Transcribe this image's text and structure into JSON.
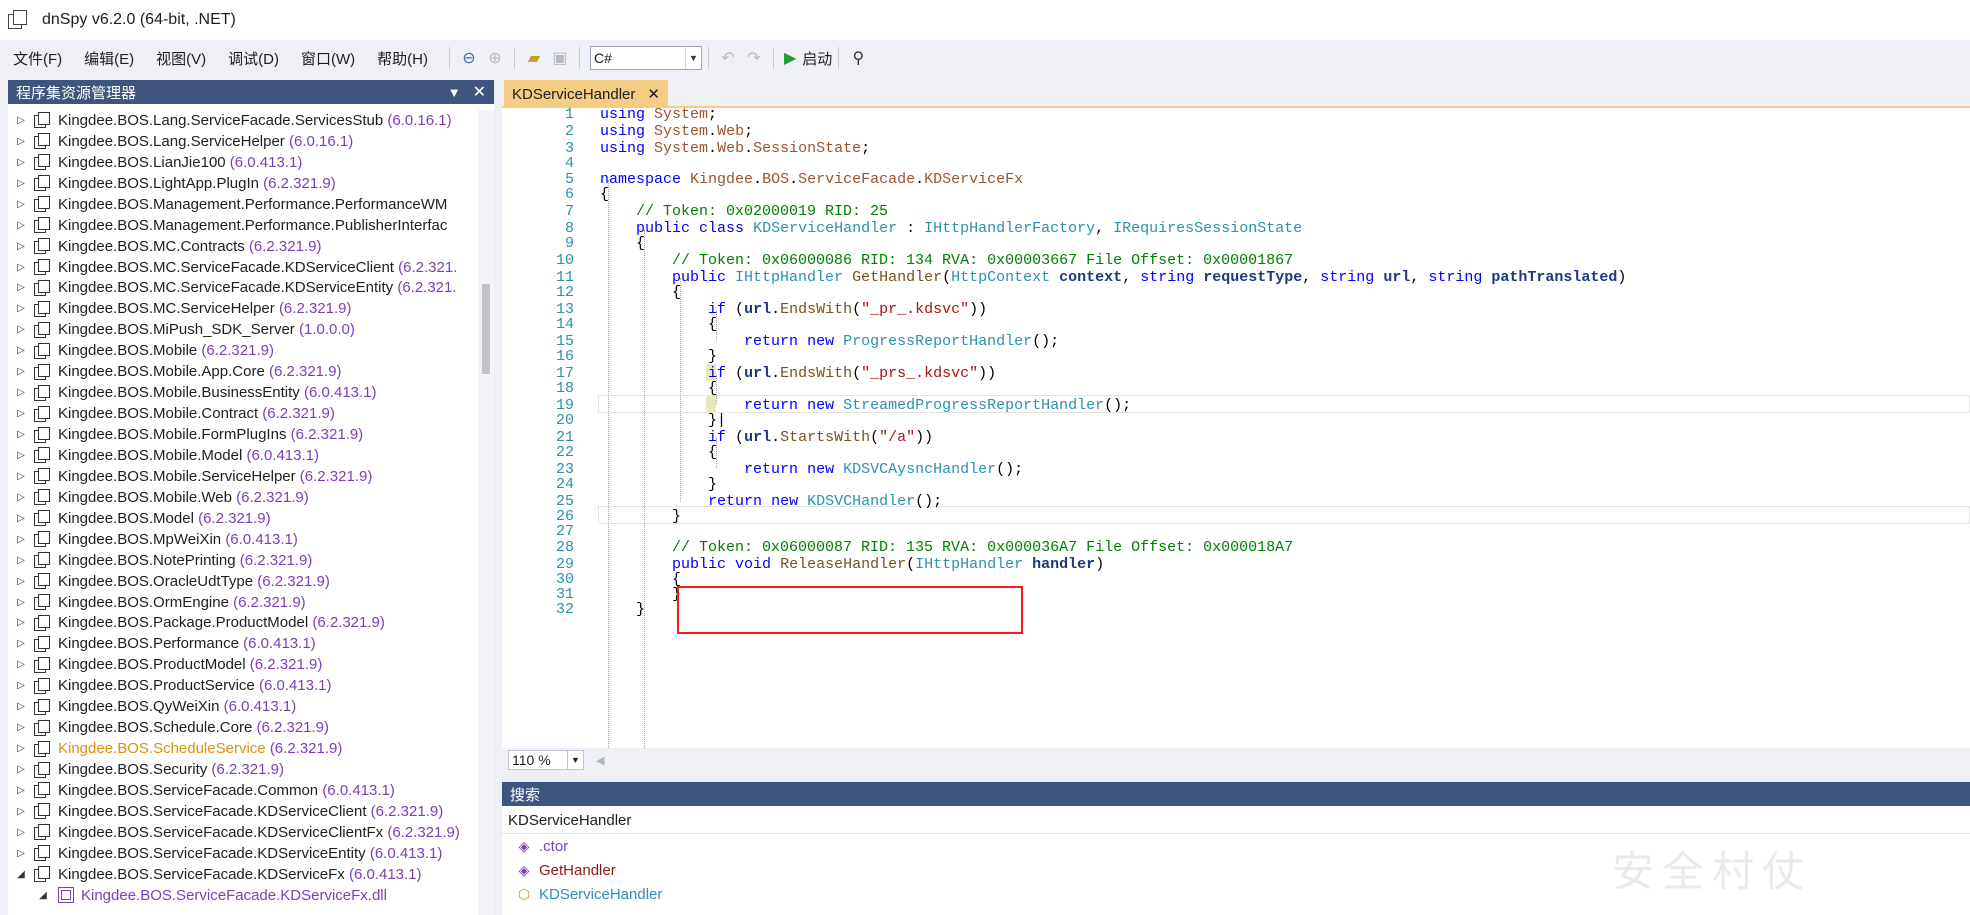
{
  "window": {
    "title": "dnSpy v6.2.0 (64-bit, .NET)"
  },
  "menu": [
    "文件(F)",
    "编辑(E)",
    "视图(V)",
    "调试(D)",
    "窗口(W)",
    "帮助(H)"
  ],
  "toolbar": {
    "language": "C#",
    "run_label": "启动",
    "icons": [
      "back-arrow-icon",
      "forward-arrow-icon",
      "open-folder-icon",
      "save-icon",
      "undo-icon",
      "redo-icon",
      "play-icon",
      "search-icon"
    ]
  },
  "assembly_explorer": {
    "title": "程序集资源管理器",
    "items": [
      {
        "name": "Kingdee.BOS.Lang.ServiceFacade.ServicesStub",
        "version": "(6.0.16.1)"
      },
      {
        "name": "Kingdee.BOS.Lang.ServiceHelper",
        "version": "(6.0.16.1)"
      },
      {
        "name": "Kingdee.BOS.LianJie100",
        "version": "(6.0.413.1)"
      },
      {
        "name": "Kingdee.BOS.LightApp.PlugIn",
        "version": "(6.2.321.9)"
      },
      {
        "name": "Kingdee.BOS.Management.Performance.PerformanceWM",
        "version": ""
      },
      {
        "name": "Kingdee.BOS.Management.Performance.PublisherInterfac",
        "version": ""
      },
      {
        "name": "Kingdee.BOS.MC.Contracts",
        "version": "(6.2.321.9)"
      },
      {
        "name": "Kingdee.BOS.MC.ServiceFacade.KDServiceClient",
        "version": "(6.2.321."
      },
      {
        "name": "Kingdee.BOS.MC.ServiceFacade.KDServiceEntity",
        "version": "(6.2.321."
      },
      {
        "name": "Kingdee.BOS.MC.ServiceHelper",
        "version": "(6.2.321.9)"
      },
      {
        "name": "Kingdee.BOS.MiPush_SDK_Server",
        "version": "(1.0.0.0)"
      },
      {
        "name": "Kingdee.BOS.Mobile",
        "version": "(6.2.321.9)"
      },
      {
        "name": "Kingdee.BOS.Mobile.App.Core",
        "version": "(6.2.321.9)"
      },
      {
        "name": "Kingdee.BOS.Mobile.BusinessEntity",
        "version": "(6.0.413.1)"
      },
      {
        "name": "Kingdee.BOS.Mobile.Contract",
        "version": "(6.2.321.9)"
      },
      {
        "name": "Kingdee.BOS.Mobile.FormPlugIns",
        "version": "(6.2.321.9)"
      },
      {
        "name": "Kingdee.BOS.Mobile.Model",
        "version": "(6.0.413.1)"
      },
      {
        "name": "Kingdee.BOS.Mobile.ServiceHelper",
        "version": "(6.2.321.9)"
      },
      {
        "name": "Kingdee.BOS.Mobile.Web",
        "version": "(6.2.321.9)"
      },
      {
        "name": "Kingdee.BOS.Model",
        "version": "(6.2.321.9)"
      },
      {
        "name": "Kingdee.BOS.MpWeiXin",
        "version": "(6.0.413.1)"
      },
      {
        "name": "Kingdee.BOS.NotePrinting",
        "version": "(6.2.321.9)"
      },
      {
        "name": "Kingdee.BOS.OracleUdtType",
        "version": "(6.2.321.9)"
      },
      {
        "name": "Kingdee.BOS.OrmEngine",
        "version": "(6.2.321.9)"
      },
      {
        "name": "Kingdee.BOS.Package.ProductModel",
        "version": "(6.2.321.9)"
      },
      {
        "name": "Kingdee.BOS.Performance",
        "version": "(6.0.413.1)"
      },
      {
        "name": "Kingdee.BOS.ProductModel",
        "version": "(6.2.321.9)"
      },
      {
        "name": "Kingdee.BOS.ProductService",
        "version": "(6.0.413.1)"
      },
      {
        "name": "Kingdee.BOS.QyWeiXin",
        "version": "(6.0.413.1)"
      },
      {
        "name": "Kingdee.BOS.Schedule.Core",
        "version": "(6.2.321.9)"
      },
      {
        "name": "Kingdee.BOS.ScheduleService",
        "version": "(6.2.321.9)"
      },
      {
        "name": "Kingdee.BOS.Security",
        "version": "(6.2.321.9)"
      },
      {
        "name": "Kingdee.BOS.ServiceFacade.Common",
        "version": "(6.0.413.1)"
      },
      {
        "name": "Kingdee.BOS.ServiceFacade.KDServiceClient",
        "version": "(6.2.321.9)"
      },
      {
        "name": "Kingdee.BOS.ServiceFacade.KDServiceClientFx",
        "version": "(6.2.321.9)"
      },
      {
        "name": "Kingdee.BOS.ServiceFacade.KDServiceEntity",
        "version": "(6.0.413.1)"
      },
      {
        "name": "Kingdee.BOS.ServiceFacade.KDServiceFx",
        "version": "(6.0.413.1)"
      }
    ],
    "highlighted_item": "Kingdee.BOS.ScheduleService",
    "expanded_child": "Kingdee.BOS.ServiceFacade.KDServiceFx.dll"
  },
  "editor": {
    "tab_label": "KDServiceHandler",
    "zoom": "110 %",
    "line_numbers": [
      "1",
      "2",
      "3",
      "4",
      "5",
      "6",
      "7",
      "8",
      "9",
      "10",
      "11",
      "12",
      "13",
      "14",
      "15",
      "16",
      "17",
      "18",
      "19",
      "20",
      "21",
      "22",
      "23",
      "24",
      "25",
      "26",
      "27",
      "28",
      "29",
      "30",
      "31",
      "32"
    ],
    "code": {
      "l1_kw": "using",
      "l1_ns": "System",
      "l2_kw": "using",
      "l2_ns1": "System",
      "l2_ns2": "Web",
      "l3_kw": "using",
      "l3_ns1": "System",
      "l3_ns2": "Web",
      "l3_ns3": "SessionState",
      "l5_kw": "namespace",
      "l5_ns1": "Kingdee",
      "l5_ns2": "BOS",
      "l5_ns3": "ServiceFacade",
      "l5_ns4": "KDServiceFx",
      "l7_cm": "// Token: 0x02000019 RID: 25",
      "l8_kw1": "public",
      "l8_kw2": "class",
      "l8_ty1": "KDServiceHandler",
      "l8_ty2": "IHttpHandlerFactory",
      "l8_ty3": "IRequiresSessionState",
      "l10_cm": "// Token: 0x06000086 RID: 134 RVA: 0x00003667 File Offset: 0x00001867",
      "l11_kw1": "public",
      "l11_ty1": "IHttpHandler",
      "l11_mt": "GetHandler",
      "l11_ty2": "HttpContext",
      "l11_p1": "context",
      "l11_kw2": "string",
      "l11_p2": "requestType",
      "l11_kw3": "string",
      "l11_p3": "url",
      "l11_kw4": "string",
      "l11_p4": "pathTranslated",
      "l13_kw": "if",
      "l13_p": "url",
      "l13_mt": "EndsWith",
      "l13_str": "\"_pr_.kdsvc\"",
      "l15_kw1": "return",
      "l15_kw2": "new",
      "l15_ty": "ProgressReportHandler",
      "l17_kw": "if",
      "l17_p": "url",
      "l17_mt": "EndsWith",
      "l17_str": "\"_prs_.kdsvc\"",
      "l19_kw1": "return",
      "l19_kw2": "new",
      "l19_ty": "StreamedProgressReportHandler",
      "l21_kw": "if",
      "l21_p": "url",
      "l21_mt": "StartsWith",
      "l21_str": "\"/a\"",
      "l23_kw1": "return",
      "l23_kw2": "new",
      "l23_ty": "KDSVCAysncHandler",
      "l25_kw1": "return",
      "l25_kw2": "new",
      "l25_ty": "KDSVCHandler",
      "l28_cm": "// Token: 0x06000087 RID: 135 RVA: 0x000036A7 File Offset: 0x000018A7",
      "l29_kw1": "public",
      "l29_kw2": "void",
      "l29_mt": "ReleaseHandler",
      "l29_ty": "IHttpHandler",
      "l29_p": "handler"
    }
  },
  "search_panel": {
    "title": "搜索",
    "query": "KDServiceHandler",
    "results": [
      {
        "kind": "ctor",
        "name": ".ctor"
      },
      {
        "kind": "method",
        "name": "GetHandler"
      },
      {
        "kind": "type",
        "name": "KDServiceHandler"
      }
    ]
  },
  "watermark": "安全村仗"
}
